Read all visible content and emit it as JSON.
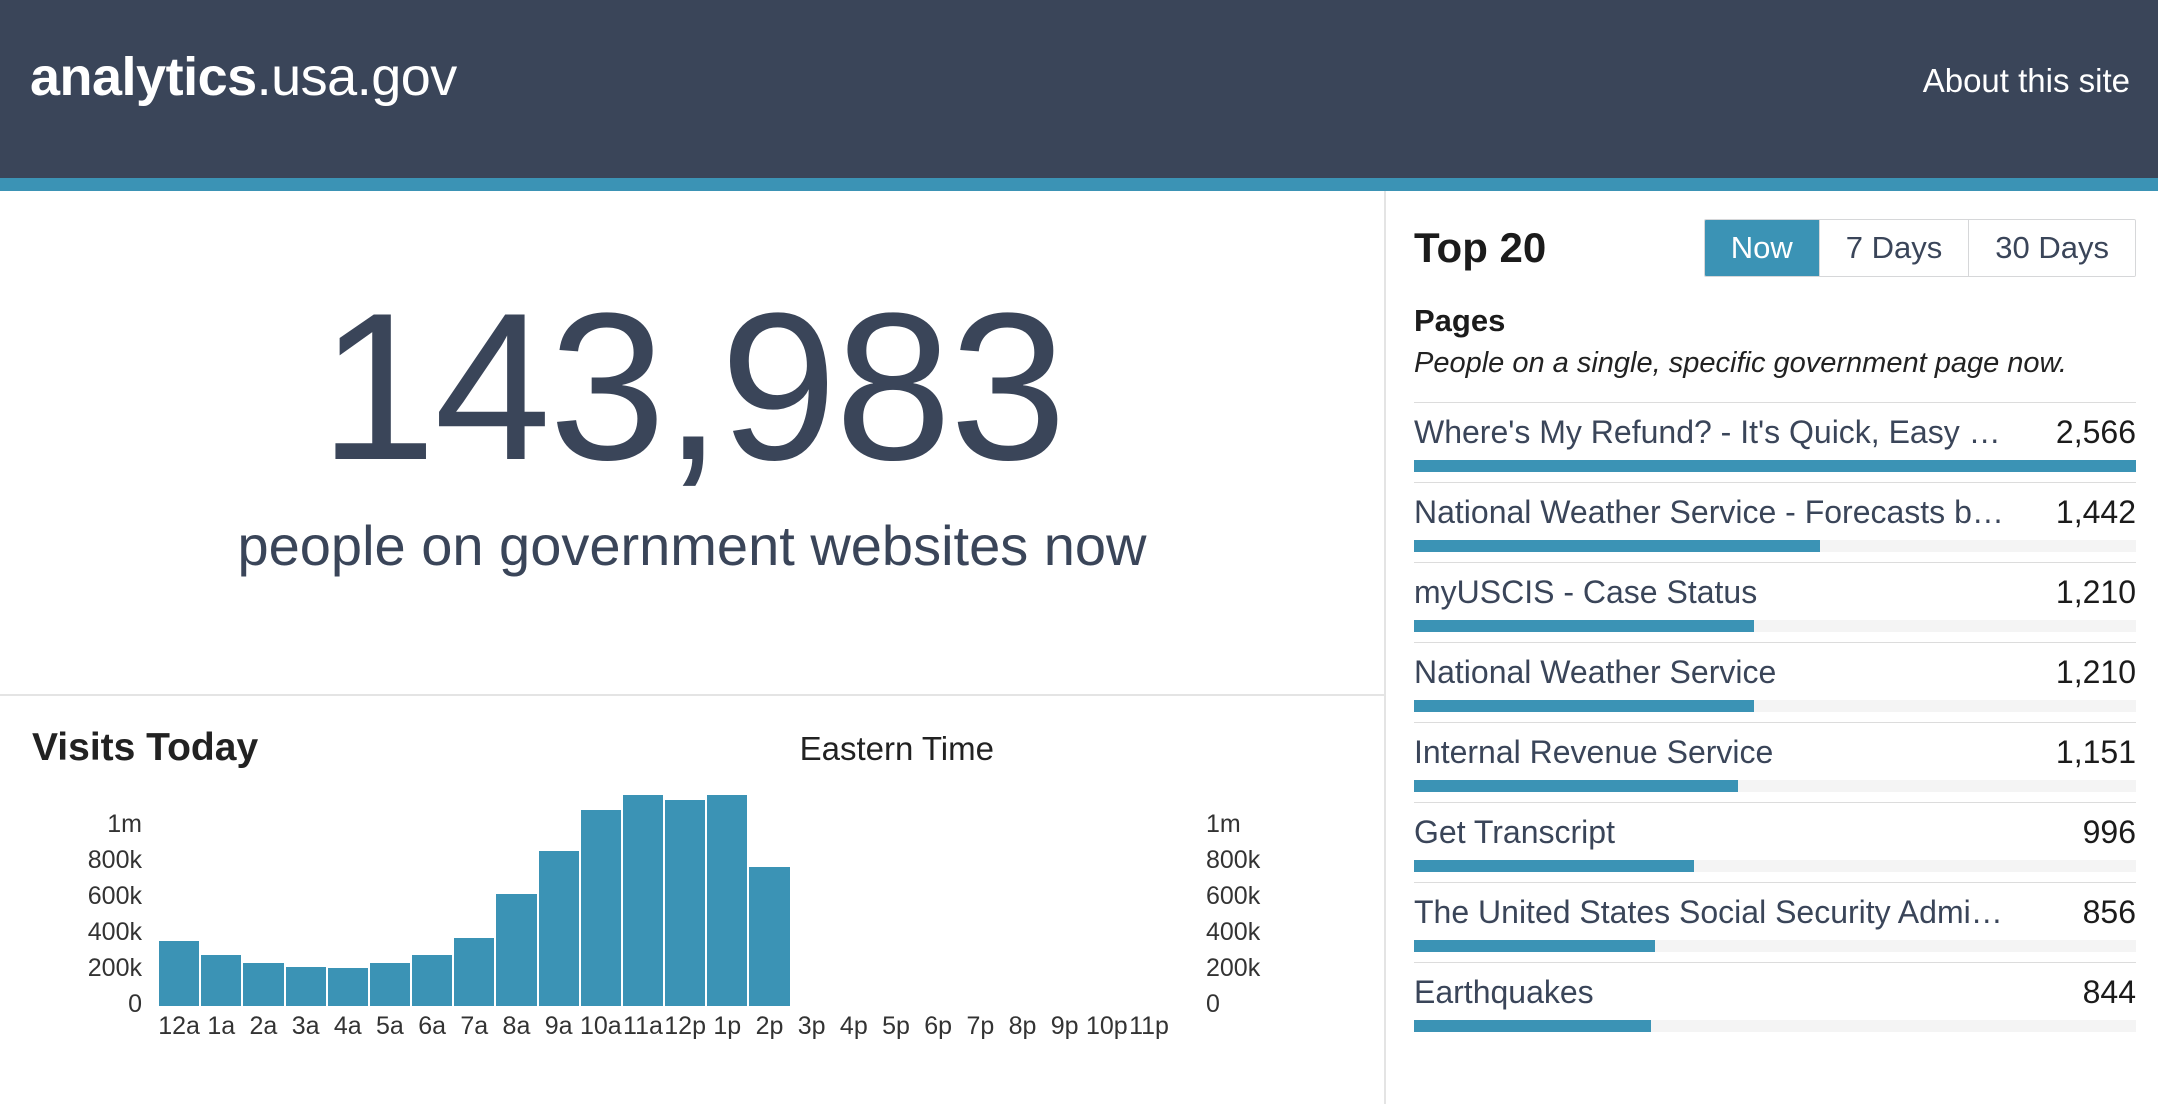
{
  "header": {
    "brand_bold": "analytics",
    "brand_rest": ".usa.gov",
    "about_label": "About this site",
    "bar_color": "#3b93b5",
    "background_color": "#3a4559"
  },
  "realtime": {
    "count": "143,983",
    "caption": "people on government websites now"
  },
  "chart": {
    "title": "Visits Today",
    "timezone": "Eastern Time"
  },
  "chart_data": {
    "type": "bar",
    "title": "Visits Today",
    "xlabel": "",
    "ylabel": "",
    "ylim": [
      0,
      1200000
    ],
    "grid": false,
    "bar_color": "#3b93b5",
    "y_ticks": [
      "1m",
      "800k",
      "600k",
      "400k",
      "200k",
      "0"
    ],
    "y_tick_values": [
      1000000,
      800000,
      600000,
      400000,
      200000,
      0
    ],
    "y_axis_right_ticks": [
      "1m",
      "800k",
      "600k",
      "400k",
      "200k",
      "0"
    ],
    "categories": [
      "12a",
      "1a",
      "2a",
      "3a",
      "4a",
      "5a",
      "6a",
      "7a",
      "8a",
      "9a",
      "10a",
      "11a",
      "12p",
      "1p",
      "2p",
      "3p",
      "4p",
      "5p",
      "6p",
      "7p",
      "8p",
      "9p",
      "10p",
      "11p"
    ],
    "values": [
      363000,
      285000,
      240000,
      215000,
      212000,
      240000,
      285000,
      380000,
      620000,
      860000,
      1090000,
      1170000,
      1145000,
      1170000,
      775000,
      0,
      0,
      0,
      0,
      0,
      0,
      0,
      0,
      0
    ]
  },
  "panel": {
    "title": "Top 20",
    "tabs": [
      {
        "label": "Now",
        "active": true
      },
      {
        "label": "7 Days",
        "active": false
      },
      {
        "label": "30 Days",
        "active": false
      }
    ],
    "subtitle": "Pages",
    "description": "People on a single, specific government page now.",
    "rows": [
      {
        "name": "Where's My Refund? - It's Quick, Easy and S...",
        "count": "2,566",
        "value": 2566
      },
      {
        "name": "National Weather Service - Forecasts by Re...",
        "count": "1,442",
        "value": 1442
      },
      {
        "name": "myUSCIS - Case Status",
        "count": "1,210",
        "value": 1210
      },
      {
        "name": "National Weather Service",
        "count": "1,210",
        "value": 1210
      },
      {
        "name": "Internal Revenue Service",
        "count": "1,151",
        "value": 1151
      },
      {
        "name": "Get Transcript",
        "count": "996",
        "value": 996
      },
      {
        "name": "The United States Social Security Administr...",
        "count": "856",
        "value": 856
      },
      {
        "name": "Earthquakes",
        "count": "844",
        "value": 844
      }
    ]
  }
}
